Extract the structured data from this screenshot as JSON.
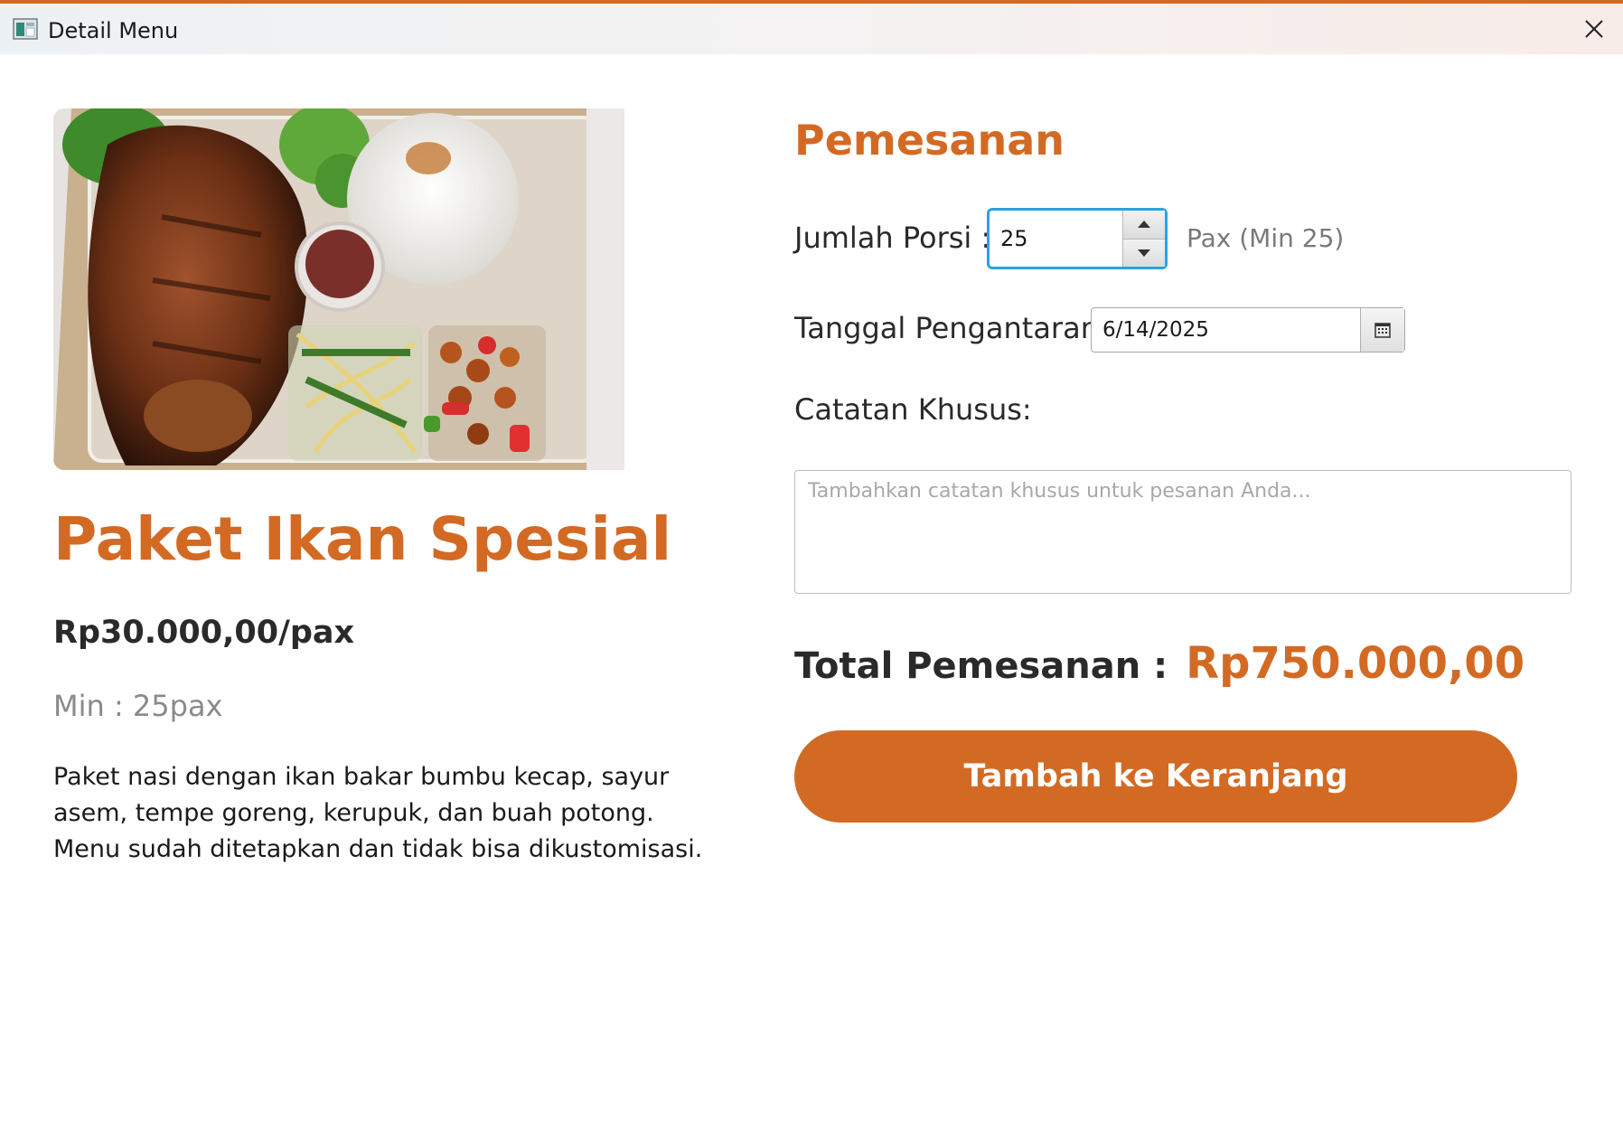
{
  "window": {
    "title": "Detail Menu"
  },
  "product": {
    "name": "Paket Ikan Spesial",
    "price": "Rp30.000,00/pax",
    "min_label": "Min : 25pax",
    "description": "Paket nasi dengan ikan bakar bumbu kecap, sayur asem, tempe goreng, kerupuk, dan buah potong. Menu sudah ditetapkan dan tidak bisa dikustomisasi."
  },
  "order": {
    "heading": "Pemesanan",
    "portion_label": "Jumlah Porsi :",
    "portion_value": "25",
    "portion_hint": "Pax (Min 25)",
    "date_label": "Tanggal Pengantaran:",
    "date_value": "6/14/2025",
    "notes_label": "Catatan Khusus:",
    "notes_placeholder": "Tambahkan catatan khusus untuk pesanan Anda...",
    "total_label": "Total Pemesanan :",
    "total_value": "Rp750.000,00",
    "add_to_cart_label": "Tambah ke Keranjang"
  },
  "colors": {
    "accent": "#d36a24",
    "focus": "#2aa3e0"
  },
  "icons": [
    "app-icon",
    "close-icon",
    "spinner-up-icon",
    "spinner-down-icon",
    "calendar-icon"
  ]
}
